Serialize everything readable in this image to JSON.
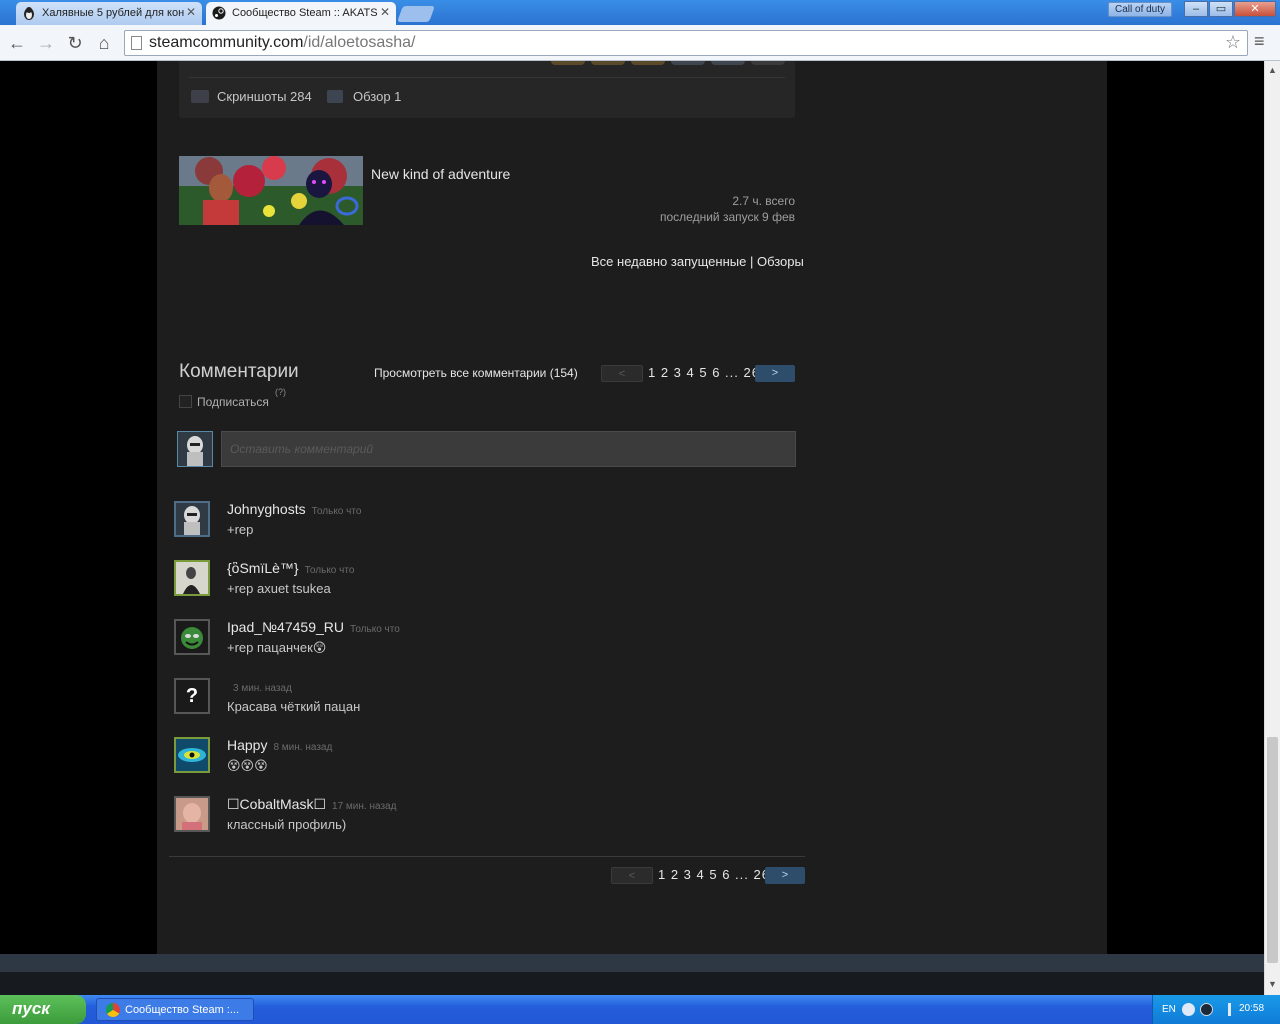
{
  "browser": {
    "tabs": [
      {
        "title": "Халявные 5 рублей для кон",
        "active": false
      },
      {
        "title": "Сообщество Steam :: AKATS",
        "active": true
      }
    ],
    "profile_button": "Call of duty",
    "url_host": "steamcommunity.com",
    "url_path": "/id/aloetosasha/",
    "window_controls": {
      "minimize": "–",
      "maximize": "▭",
      "close": "✕"
    }
  },
  "showcase": {
    "screenshots_label": "Скриншоты 284",
    "reviews_label": "Обзор 1"
  },
  "recent_game": {
    "name": "New kind of adventure",
    "hours": "2.7 ч. всего",
    "last_played": "последний запуск 9 фев",
    "links": {
      "recent": "Все недавно запущенные",
      "separator": "|",
      "reviews": "Обзоры"
    }
  },
  "comments": {
    "title": "Комментарии",
    "view_all": "Просмотреть все комментарии (154)",
    "pager": {
      "prev": "<",
      "next": ">",
      "pages": "1 2 3 4 5 6 ... 26"
    },
    "subscribe": "Подписаться",
    "subscribe_help": "(?)",
    "input_placeholder": "Оставить комментарий",
    "items": [
      {
        "author": "Johnyghosts",
        "time": "Только что",
        "text": "+rep"
      },
      {
        "author": "{ὃSmïLè™}",
        "time": "Только что",
        "text": "+rep axuet tsukea"
      },
      {
        "author": "Ipad_№47459_RU",
        "time": "Только что",
        "text": "+rep пацанчек😲"
      },
      {
        "author": "",
        "time": "3 мин. назад",
        "text": "Красава чёткий пацан"
      },
      {
        "author": "Happy",
        "time": "8 мин. назад",
        "text": "😵😵😵"
      },
      {
        "author": "☐CobaltMask☐",
        "time": "17 мин. назад",
        "text": "классный профиль)"
      }
    ]
  },
  "taskbar": {
    "start": "пуск",
    "task": "Сообщество Steam :...",
    "lang": "EN",
    "clock": "20:58"
  }
}
